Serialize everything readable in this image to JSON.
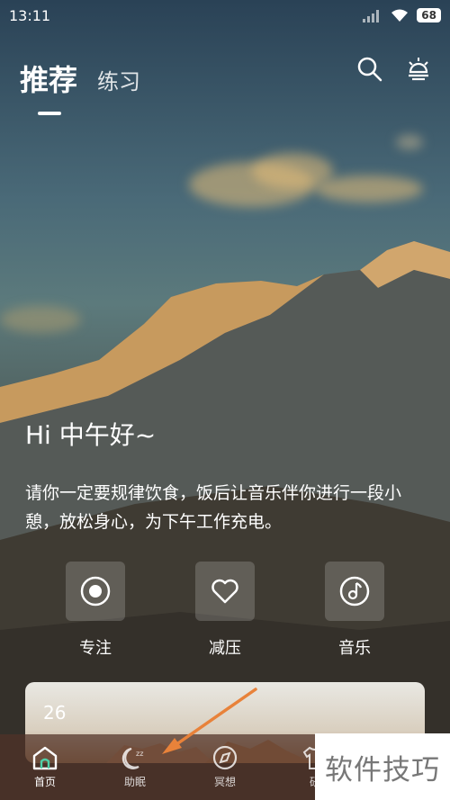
{
  "status_bar": {
    "time": "13:11",
    "battery": "68"
  },
  "tabs": [
    {
      "label": "推荐",
      "active": true
    },
    {
      "label": "练习",
      "active": false
    }
  ],
  "greeting": "Hi 中午好~",
  "description": "请你一定要规律饮食，饭后让音乐伴你进行一段小憩，放松身心，为下午工作充电。",
  "actions": [
    {
      "label": "专注",
      "icon": "focus-icon"
    },
    {
      "label": "减压",
      "icon": "heart-icon"
    },
    {
      "label": "音乐",
      "icon": "music-note-icon"
    }
  ],
  "card": {
    "number": "26"
  },
  "nav": [
    {
      "label": "首页",
      "icon": "home-icon",
      "active": true
    },
    {
      "label": "助眠",
      "icon": "sleep-moon-icon",
      "active": false
    },
    {
      "label": "冥想",
      "icon": "compass-icon",
      "active": false
    },
    {
      "label": "研",
      "icon": "shirt-icon",
      "active": false
    }
  ],
  "watermark": "软件技巧",
  "colors": {
    "accent": "#4fd0a8",
    "arrow": "#e8823a",
    "nav_bg": "#503228"
  }
}
